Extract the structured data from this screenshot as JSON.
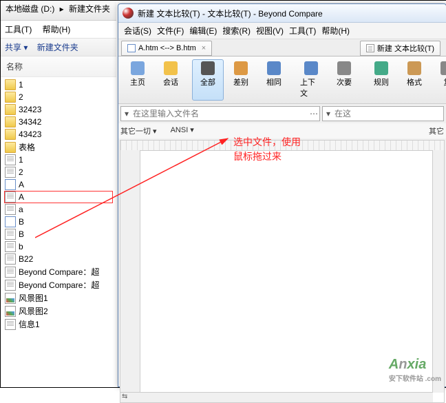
{
  "explorer": {
    "crumb_drive": "本地磁盘 (D:)",
    "crumb_sep": "▸",
    "crumb_folder": "新建文件夹",
    "menu_tools": "工具(T)",
    "menu_help": "帮助(H)",
    "tool_share": "共享 ▾",
    "tool_newfolder": "新建文件夹",
    "header_name": "名称",
    "files": [
      {
        "icon": "fld",
        "name": "1"
      },
      {
        "icon": "fld",
        "name": "2"
      },
      {
        "icon": "fld",
        "name": "32423"
      },
      {
        "icon": "fld",
        "name": "34342"
      },
      {
        "icon": "fld",
        "name": "43423"
      },
      {
        "icon": "fld",
        "name": "表格"
      },
      {
        "icon": "txt",
        "name": "1"
      },
      {
        "icon": "txt",
        "name": "2"
      },
      {
        "icon": "htm",
        "name": "A"
      },
      {
        "icon": "txt",
        "name": "A",
        "sel": true
      },
      {
        "icon": "txt",
        "name": "a"
      },
      {
        "icon": "htm",
        "name": "B"
      },
      {
        "icon": "txt",
        "name": "B"
      },
      {
        "icon": "txt",
        "name": "b"
      },
      {
        "icon": "txt",
        "name": "B22"
      },
      {
        "icon": "txt",
        "name": "Beyond Compare：超"
      },
      {
        "icon": "txt",
        "name": "Beyond Compare：超"
      },
      {
        "icon": "png",
        "name": "风景图1"
      },
      {
        "icon": "png",
        "name": "风景图2"
      },
      {
        "icon": "txt",
        "name": "信息1"
      }
    ]
  },
  "bc": {
    "title": "新建 文本比较(T) - 文本比较(T) - Beyond Compare",
    "menu": [
      "会话(S)",
      "文件(F)",
      "编辑(E)",
      "搜索(R)",
      "视图(V)",
      "工具(T)",
      "帮助(H)"
    ],
    "tab1": "A.htm <--> B.htm",
    "tab2": "新建 文本比较(T)",
    "toolbar": [
      {
        "label": "主页",
        "color": "#7aa6de"
      },
      {
        "label": "会话",
        "color": "#f2c24b"
      },
      {
        "label": "全部",
        "color": "#555",
        "act": true
      },
      {
        "label": "差别",
        "color": "#d94"
      },
      {
        "label": "相同",
        "color": "#5a88c8"
      },
      {
        "label": "上下文",
        "color": "#5a88c8"
      },
      {
        "label": "次要",
        "color": "#888"
      },
      {
        "label": "规则",
        "color": "#4a8"
      },
      {
        "label": "格式",
        "color": "#c95"
      },
      {
        "label": "复"
      }
    ],
    "placeholder_left": "在这里输入文件名",
    "placeholder_right": "在这",
    "filter_left": "其它一切 ▾",
    "filter_mid": "ANSI ▾",
    "filter_right": "其它"
  },
  "anno": {
    "l1": "选中文件，使用",
    "l2": "鼠标拖过来"
  },
  "logo": {
    "main": "Anxia",
    "sub": "安下软件站 .com"
  }
}
